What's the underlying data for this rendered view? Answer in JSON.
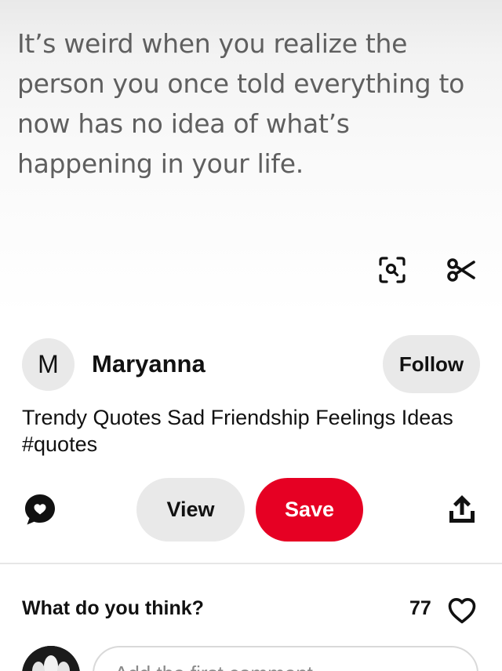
{
  "pin": {
    "quote": "It’s weird when you realize the\nperson you once told everything to\nnow has no idea of what’s\nhappening in your life.",
    "tools": {
      "visual_search_icon": "visual-search-icon",
      "crop_icon": "scissors-icon"
    }
  },
  "creator": {
    "avatar_initial": "M",
    "name": "Maryanna",
    "follow_label": "Follow"
  },
  "description": "Trendy Quotes Sad Friendship Feelings Ideas #quotes",
  "actions": {
    "comment_icon": "comment-bubble-icon",
    "view_label": "View",
    "save_label": "Save",
    "share_icon": "share-upload-icon"
  },
  "comments": {
    "title": "What do you think?",
    "like_count": "77",
    "heart_icon": "heart-icon",
    "input_placeholder": "Add the first comment"
  },
  "colors": {
    "save_red": "#e60023",
    "pill_gray": "#e9e9e9",
    "text_dark": "#111111"
  }
}
